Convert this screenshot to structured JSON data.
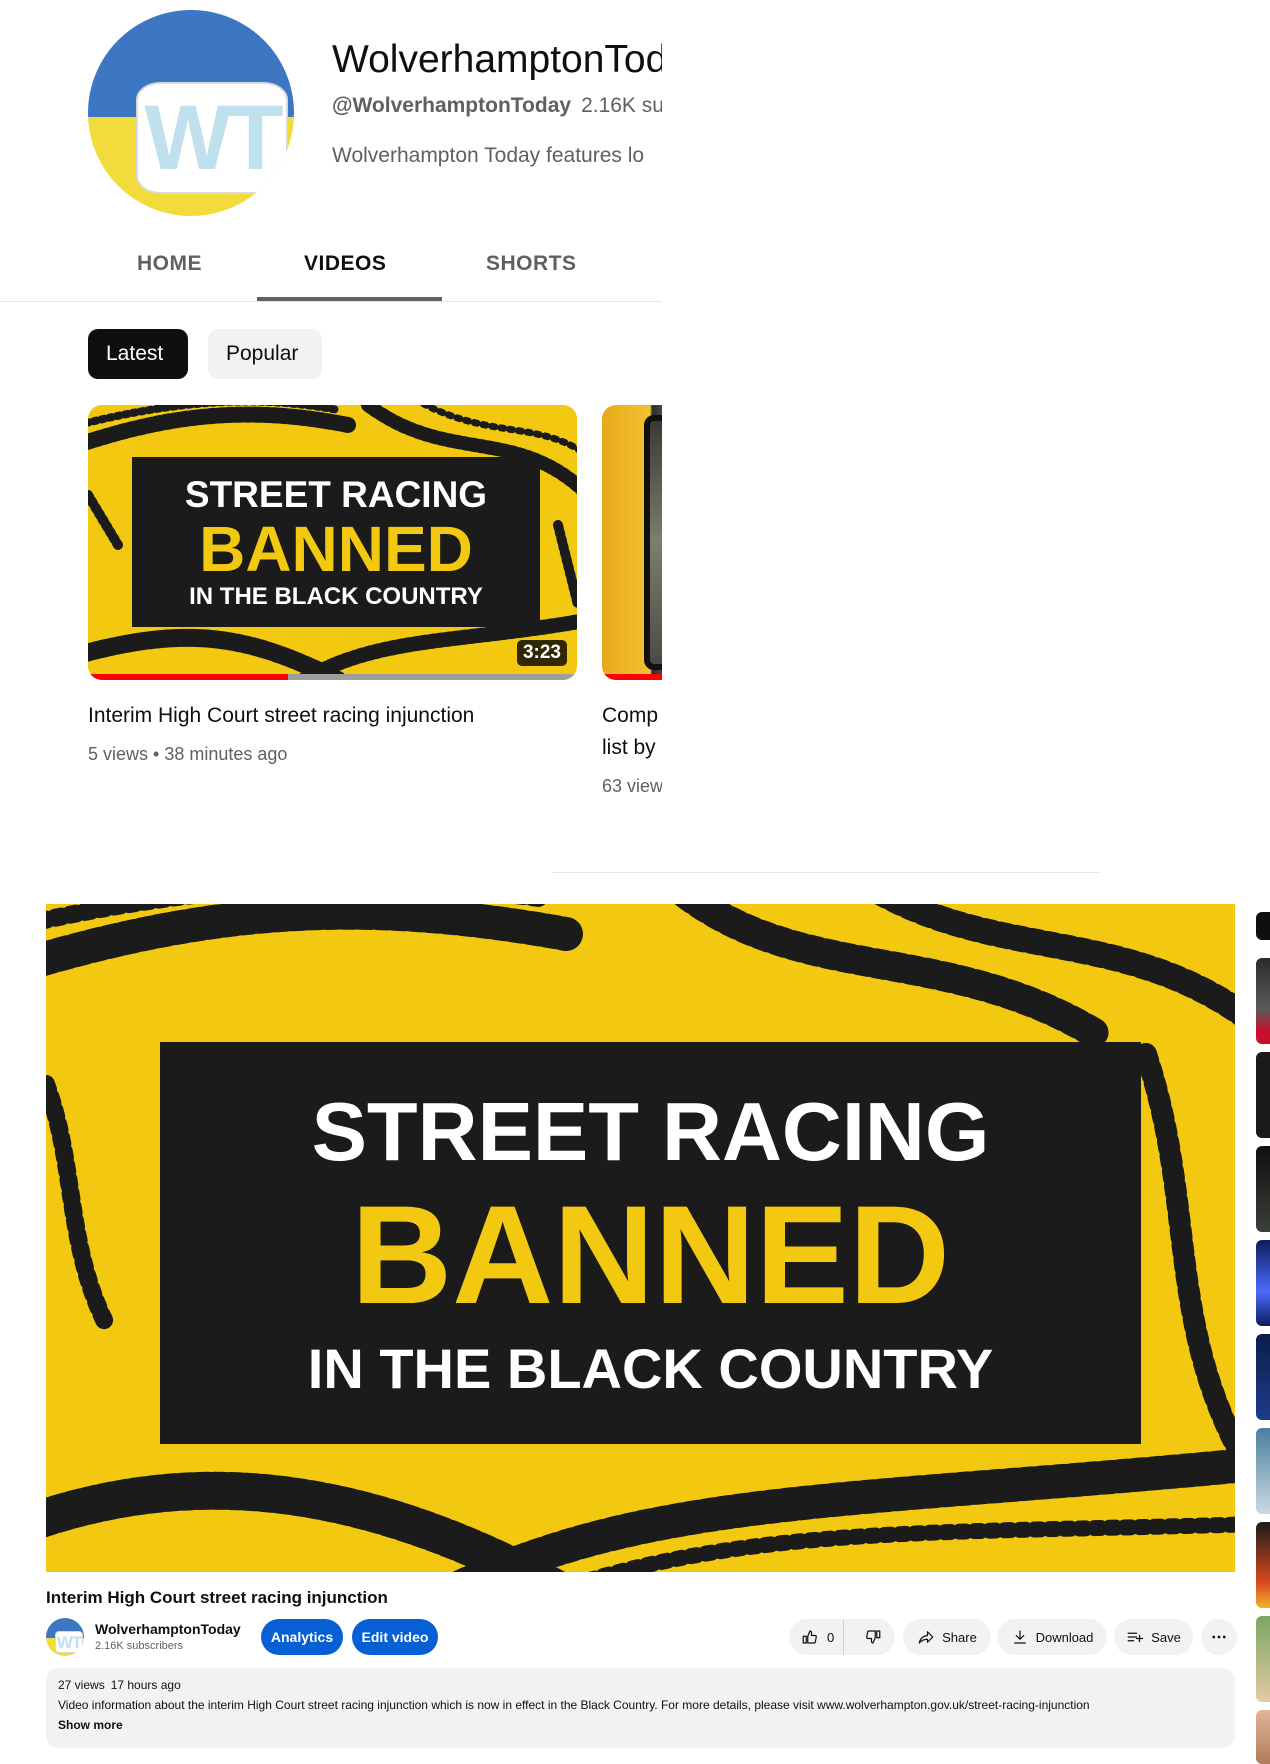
{
  "colors": {
    "brand_blue": "#3d77c4",
    "brand_yellow": "#f2dc3c",
    "artwork_yellow": "#f2c910",
    "progress_red": "#ff0000",
    "button_blue": "#065fd4"
  },
  "channel": {
    "name": "WolverhamptonTod",
    "handle": "@WolverhamptonToday",
    "subs": "2.16K su",
    "description": "Wolverhampton Today features lo",
    "avatar_text": "WT",
    "tabs": [
      {
        "label": "HOME",
        "active": false
      },
      {
        "label": "VIDEOS",
        "active": true
      },
      {
        "label": "SHORTS",
        "active": false
      }
    ],
    "chips": [
      {
        "label": "Latest",
        "selected": true
      },
      {
        "label": "Popular",
        "selected": false
      }
    ]
  },
  "artwork": {
    "line1": "STREET RACING",
    "line2": "BANNED",
    "line3": "IN THE BLACK COUNTRY"
  },
  "videos": [
    {
      "duration": "3:23",
      "watched_fraction": 0.41,
      "title": "Interim High Court street racing injunction",
      "views": "5 views",
      "age": "38 minutes ago"
    },
    {
      "watched_fraction": 0.6,
      "title_line1": "Comp",
      "title_line2": "list by",
      "meta": "63 view"
    }
  ],
  "watch": {
    "title": "Interim High Court street racing injunction",
    "owner_name": "WolverhamptonToday",
    "owner_subs": "2.16K subscribers",
    "analytics_label": "Analytics",
    "edit_label": "Edit video",
    "like_count": "0",
    "share_label": "Share",
    "download_label": "Download",
    "save_label": "Save",
    "views": "27 views",
    "age": "17 hours ago",
    "description": "Video information about the interim High Court street racing injunction which is now in effect in the Black Country. For more details, please visit www.wolverhampton.gov.uk/street-racing-injunction",
    "show_more": "Show more"
  },
  "icons": {
    "like": "thumbs-up-icon",
    "dislike": "thumbs-down-icon",
    "share": "share-arrow-icon",
    "download": "download-icon",
    "save": "playlist-add-icon",
    "more": "more-horizontal-icon"
  }
}
